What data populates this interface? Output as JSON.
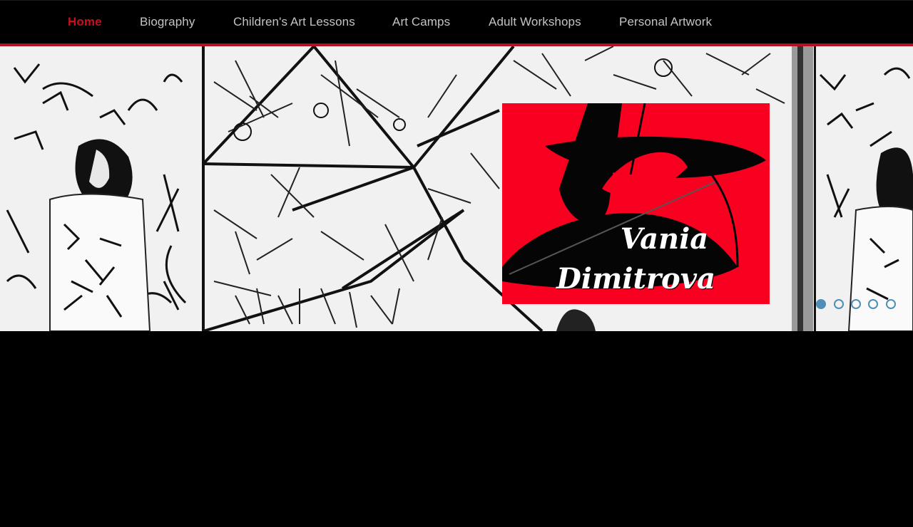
{
  "nav": {
    "items": [
      {
        "label": "Home",
        "active": true
      },
      {
        "label": "Biography",
        "active": false
      },
      {
        "label": "Children's Art Lessons",
        "active": false
      },
      {
        "label": "Art Camps",
        "active": false
      },
      {
        "label": "Adult Workshops",
        "active": false
      },
      {
        "label": "Personal Artwork",
        "active": false
      }
    ]
  },
  "hero": {
    "logo": {
      "line1": "Vania",
      "line2": "Dimitrova"
    },
    "slider": {
      "count": 5,
      "active_index": 0
    }
  },
  "colors": {
    "accent": "#c8101a",
    "rule": "#b3121c",
    "logo_bg": "#f8001f",
    "dot": "#4f8fb7"
  }
}
